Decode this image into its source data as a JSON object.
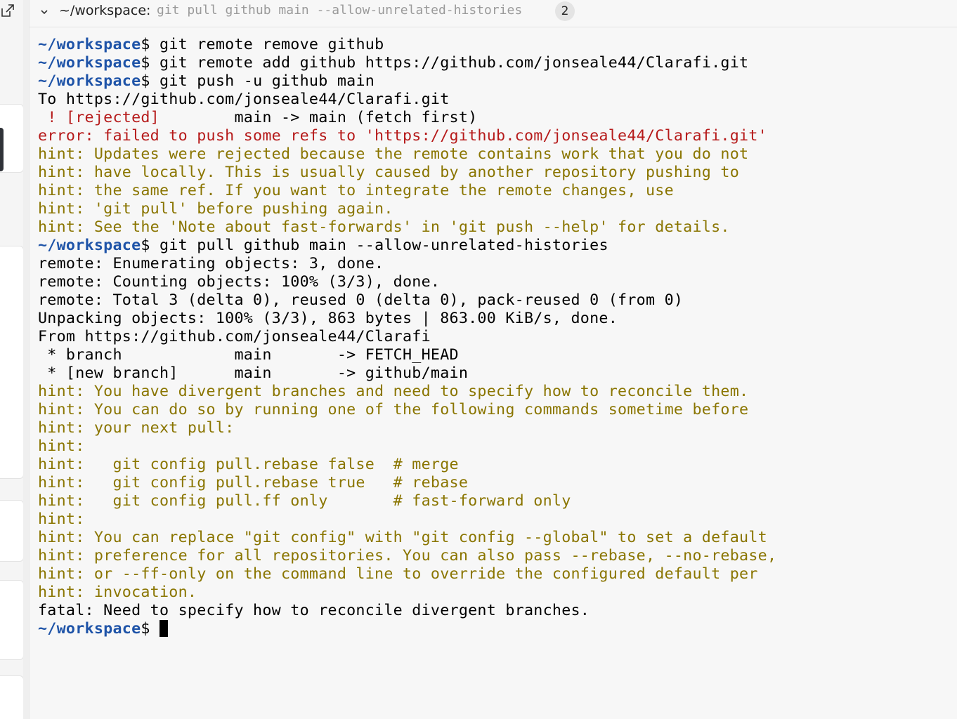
{
  "header": {
    "path": "~/workspace:",
    "command": "git pull github main --allow-unrelated-histories",
    "badge_count": "2"
  },
  "prompt": {
    "path": "~/workspace",
    "symbol": "$"
  },
  "terminal": {
    "lines": [
      {
        "type": "command",
        "text": " git remote remove github"
      },
      {
        "type": "command",
        "text": " git remote add github https://github.com/jonseale44/Clarafi.git"
      },
      {
        "type": "command",
        "text": " git push -u github main"
      },
      {
        "type": "default",
        "text": "To https://github.com/jonseale44/Clarafi.git"
      },
      {
        "type": "rejected",
        "parts": [
          {
            "style": "red",
            "text": " ! [rejected]        "
          },
          {
            "style": "default",
            "text": "main -> main (fetch first)"
          }
        ]
      },
      {
        "type": "red",
        "text": "error: failed to push some refs to 'https://github.com/jonseale44/Clarafi.git'"
      },
      {
        "type": "hint",
        "text": "hint: Updates were rejected because the remote contains work that you do not"
      },
      {
        "type": "hint",
        "text": "hint: have locally. This is usually caused by another repository pushing to"
      },
      {
        "type": "hint",
        "text": "hint: the same ref. If you want to integrate the remote changes, use"
      },
      {
        "type": "hint",
        "text": "hint: 'git pull' before pushing again."
      },
      {
        "type": "hint",
        "text": "hint: See the 'Note about fast-forwards' in 'git push --help' for details."
      },
      {
        "type": "command",
        "text": " git pull github main --allow-unrelated-histories"
      },
      {
        "type": "default",
        "text": "remote: Enumerating objects: 3, done."
      },
      {
        "type": "default",
        "text": "remote: Counting objects: 100% (3/3), done."
      },
      {
        "type": "default",
        "text": "remote: Total 3 (delta 0), reused 0 (delta 0), pack-reused 0 (from 0)"
      },
      {
        "type": "default",
        "text": "Unpacking objects: 100% (3/3), 863 bytes | 863.00 KiB/s, done."
      },
      {
        "type": "default",
        "text": "From https://github.com/jonseale44/Clarafi"
      },
      {
        "type": "default",
        "text": " * branch            main       -> FETCH_HEAD"
      },
      {
        "type": "default",
        "text": " * [new branch]      main       -> github/main"
      },
      {
        "type": "hint",
        "text": "hint: You have divergent branches and need to specify how to reconcile them."
      },
      {
        "type": "hint",
        "text": "hint: You can do so by running one of the following commands sometime before"
      },
      {
        "type": "hint",
        "text": "hint: your next pull:"
      },
      {
        "type": "hint",
        "text": "hint:"
      },
      {
        "type": "hint",
        "text": "hint:   git config pull.rebase false  # merge"
      },
      {
        "type": "hint",
        "text": "hint:   git config pull.rebase true   # rebase"
      },
      {
        "type": "hint",
        "text": "hint:   git config pull.ff only       # fast-forward only"
      },
      {
        "type": "hint",
        "text": "hint:"
      },
      {
        "type": "hint",
        "text": "hint: You can replace \"git config\" with \"git config --global\" to set a default"
      },
      {
        "type": "hint",
        "text": "hint: preference for all repositories. You can also pass --rebase, --no-rebase,"
      },
      {
        "type": "hint",
        "text": "hint: or --ff-only on the command line to override the configured default per"
      },
      {
        "type": "hint",
        "text": "hint: invocation."
      },
      {
        "type": "default",
        "text": "fatal: Need to specify how to reconcile divergent branches."
      },
      {
        "type": "prompt-only",
        "text": " "
      }
    ]
  },
  "colors": {
    "prompt_path": "#1f54a8",
    "error_red": "#b61a1a",
    "hint_olive": "#8a7500",
    "text": "#000000",
    "background": "#f7f7f7"
  },
  "icons": {
    "open_external": "open-external-icon",
    "collapse": "chevron-down-icon"
  }
}
